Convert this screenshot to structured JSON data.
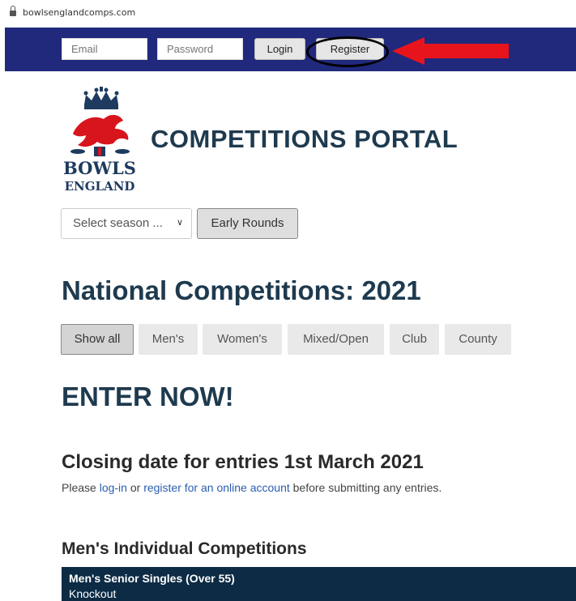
{
  "browser": {
    "url": "bowlsenglandcomps.com"
  },
  "topbar": {
    "email_placeholder": "Email",
    "password_placeholder": "Password",
    "login_label": "Login",
    "register_label": "Register"
  },
  "logo": {
    "line1": "BOWLS",
    "line2": "ENGLAND"
  },
  "header": {
    "title": "COMPETITIONS PORTAL"
  },
  "controls": {
    "season_value": "Select season ...",
    "early_rounds_label": "Early Rounds"
  },
  "main": {
    "heading": "National Competitions: 2021",
    "filters": [
      "Show all",
      "Men's",
      "Women's",
      "Mixed/Open",
      "Club",
      "County"
    ],
    "enter_heading": "ENTER NOW!",
    "closing_heading": "Closing date for entries 1st March 2021",
    "note": {
      "prefix": "Please ",
      "login_link": "log-in",
      "middle": " or ",
      "register_link": "register for an online account",
      "suffix": " before submitting any entries."
    },
    "section_heading": "Men's Individual Competitions",
    "competitions": [
      {
        "name": "Men's Senior Singles (Over 55)",
        "format": "Knockout"
      }
    ]
  },
  "colors": {
    "topbar": "#20297c",
    "heading": "#1e3a4f",
    "competition_row": "#0d2b45",
    "link": "#2a5db0",
    "annotation_arrow": "#e8141c"
  }
}
